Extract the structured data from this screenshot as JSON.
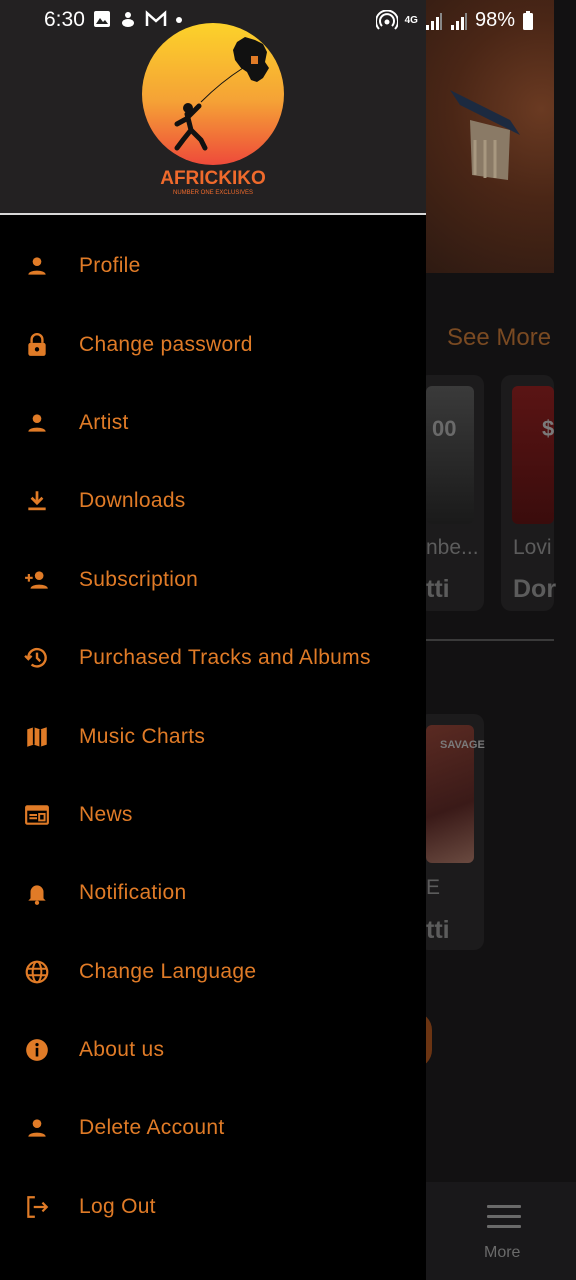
{
  "status_bar": {
    "time": "6:30",
    "network": "4G",
    "battery": "98%"
  },
  "drawer": {
    "logo": {
      "brand": "AFRICKIKO",
      "tagline": "NUMBER ONE EXCLUSIVES"
    },
    "accent_color": "#e07b27",
    "items": [
      {
        "label": "Profile",
        "icon": "person-icon"
      },
      {
        "label": "Change password",
        "icon": "lock-icon"
      },
      {
        "label": "Artist",
        "icon": "person-icon"
      },
      {
        "label": "Downloads",
        "icon": "download-icon"
      },
      {
        "label": "Subscription",
        "icon": "person-add-icon"
      },
      {
        "label": "Purchased Tracks and Albums",
        "icon": "history-icon"
      },
      {
        "label": "Music Charts",
        "icon": "map-icon"
      },
      {
        "label": "News",
        "icon": "newspaper-icon"
      },
      {
        "label": "Notification",
        "icon": "bell-icon"
      },
      {
        "label": "Change Language",
        "icon": "globe-icon"
      },
      {
        "label": "About us",
        "icon": "info-icon"
      },
      {
        "label": "Delete Account",
        "icon": "person-icon"
      },
      {
        "label": "Log Out",
        "icon": "logout-icon"
      }
    ]
  },
  "background": {
    "see_more": "See More",
    "card1": {
      "art_text": "00",
      "title": "nbe...",
      "artist": "tti"
    },
    "card2": {
      "art_text": "$",
      "title": "Lovi",
      "artist": "Dor"
    },
    "card3": {
      "art_text": "SAVAGE",
      "title": "E",
      "artist": "tti"
    },
    "bottom_nav": {
      "more_label": "More"
    }
  }
}
